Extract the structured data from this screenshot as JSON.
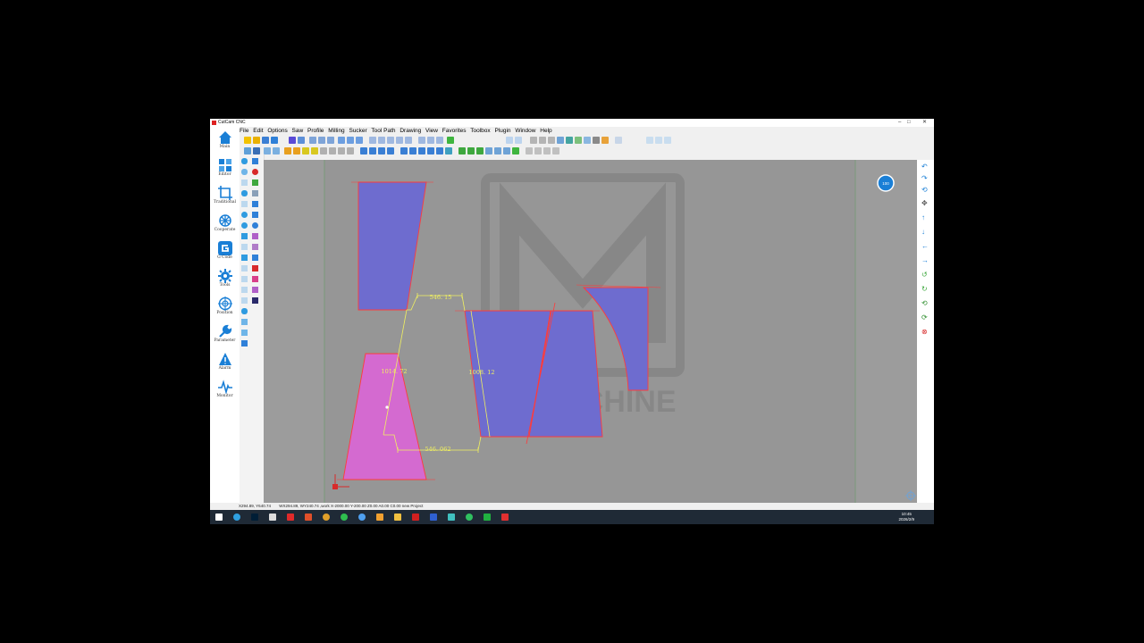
{
  "window": {
    "title": "CutCam CNC",
    "controls": [
      "–",
      "□",
      "✕"
    ]
  },
  "menu": [
    "File",
    "Edit",
    "Options",
    "Saw",
    "Profile",
    "Milling",
    "Sucker",
    "Tool Path",
    "Drawing",
    "View",
    "Favorites",
    "Toolbox",
    "Plugin",
    "Window",
    "Help"
  ],
  "nav": [
    {
      "label": "Main",
      "icon": "home-icon"
    },
    {
      "label": "Editor",
      "icon": "editor-icon"
    },
    {
      "label": "Traditional",
      "icon": "traditional-icon"
    },
    {
      "label": "Cooperate",
      "icon": "cooperate-icon"
    },
    {
      "label": "G Code",
      "icon": "gcode-icon"
    },
    {
      "label": "Tools",
      "icon": "tools-gear-icon"
    },
    {
      "label": "Position",
      "icon": "position-icon"
    },
    {
      "label": "Parameter",
      "icon": "wrench-icon"
    },
    {
      "label": "Alarm",
      "icon": "alarm-warning-icon"
    },
    {
      "label": "Monitor",
      "icon": "monitor-pulse-icon"
    }
  ],
  "canvas": {
    "watermark": "ZL MACHINE",
    "dimensions": {
      "top_width": "546. 15",
      "bottom_width": "546. 062",
      "left_height": "1014. 72",
      "right_height": "1008. 12"
    },
    "badge": "100"
  },
  "statusbar": {
    "coords": "X294.89, Y640.74",
    "info": "WX294.89, WY240.74 ,work X-2000.00 Y-200.00 Z0.00 A0.00 C0.00 new Project"
  },
  "clock": {
    "time": "10:45",
    "date": "2026/2/9"
  },
  "colors": {
    "accent": "#1a7fd6",
    "canvas": "#9c9c9c",
    "piece_blue": "#6e6ccf",
    "piece_pink": "#d46ad0",
    "outline": "#ff3b3b",
    "dimension": "#f0f060"
  }
}
